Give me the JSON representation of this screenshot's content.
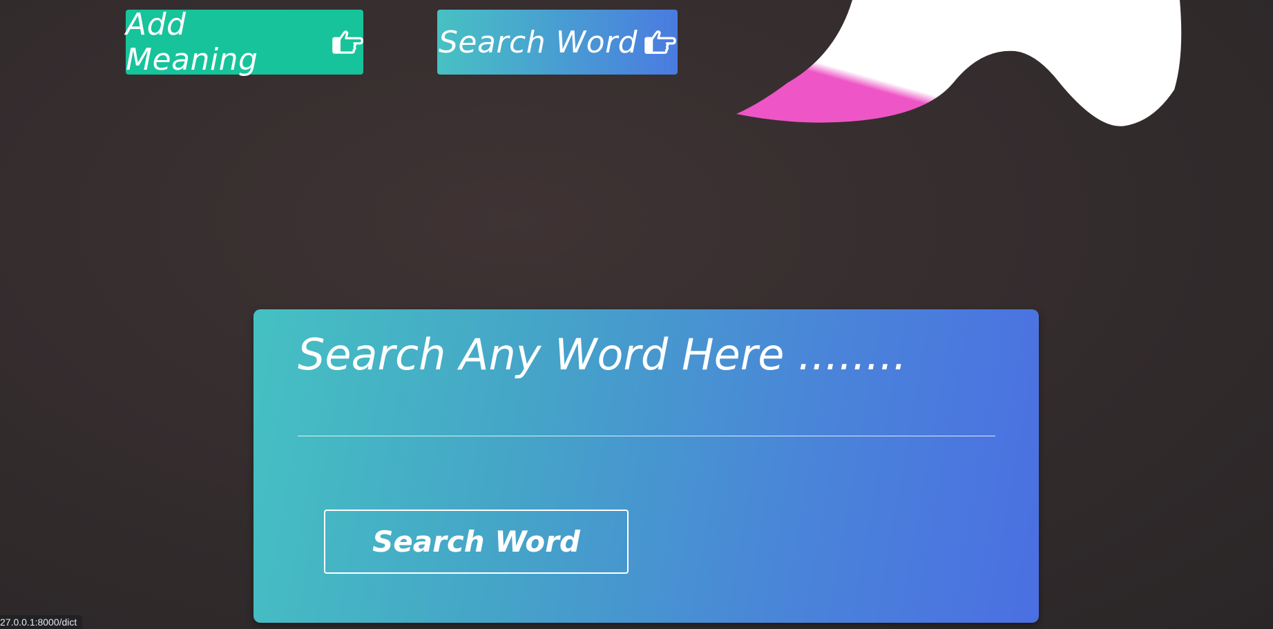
{
  "nav": {
    "add_meaning_label": "Add Meaning",
    "search_word_label": "Search Word",
    "icon": "hand-pointing-right-icon"
  },
  "search": {
    "placeholder": "Search Any Word Here ........",
    "value": "",
    "button_label": "Search Word"
  },
  "status_bar": {
    "url": "27.0.0.1:8000/dict"
  },
  "colors": {
    "add_button": "#17c39b",
    "gradient_start": "#47c1c3",
    "gradient_end": "#4a6fe2",
    "blob_pink": "#ee55c6",
    "blob_white": "#ffffff"
  }
}
